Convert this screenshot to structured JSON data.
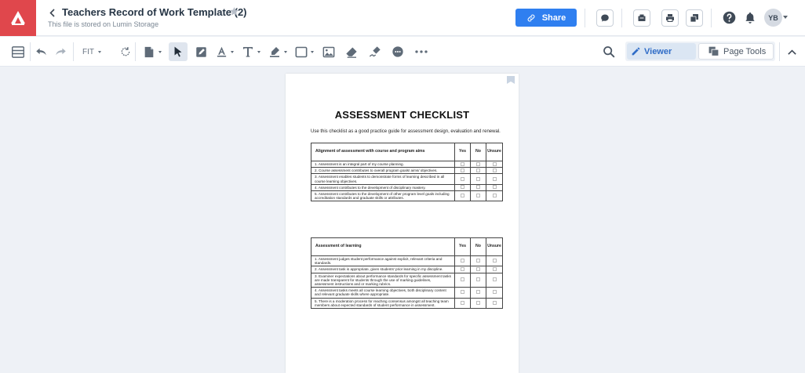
{
  "header": {
    "title": "Teachers Record of Work Template (2)",
    "subtitle": "This file is stored on Lumin Storage",
    "share_label": "Share",
    "avatar_initials": "YB"
  },
  "toolbar": {
    "zoom_label": "FIT",
    "tabs": [
      {
        "label": "Viewer",
        "active": true
      },
      {
        "label": "Page Tools",
        "active": false
      }
    ]
  },
  "document": {
    "title": "ASSESSMENT CHECKLIST",
    "intro": "Use this checklist as a good practice guide for assessment design, evaluation and renewal.",
    "columns": [
      "Yes",
      "No",
      "Unsure"
    ],
    "sections": [
      {
        "heading": "Alignment of assessment with course and program aims",
        "rows": [
          "1. Assessment is an integral part of my course planning.",
          "2. Course assessment contributes to overall program goals/ aims/ objectives.",
          "3. Assessment enables students to demonstrate forms of learning described in all course learning objectives.",
          "4. Assessment contributes to the development of disciplinary mastery.",
          "5. Assessment contributes to the development of other program level goals including accreditation standards and graduate skills or attributes."
        ]
      },
      {
        "heading": "Assessment of learning",
        "rows": [
          "1. Assessment judges student performance against explicit, relevant criteria and standards.",
          "2. Assessment task is appropriate, given students' prior learning in my discipline.",
          "3. Examiner expectations about performance standards for specific assessment tasks are made transparent for students through the use of marking guidelines, assessment instructions and or marking rubrics.",
          "4. Assessment tasks meets all course learning objectives, both disciplinary content and relevant graduate skills where appropriate.",
          "5. There is a moderation process for reaching consensus amongst all teaching team members about expected standards of student performance in assessment."
        ]
      }
    ]
  },
  "colors": {
    "brand": "#e0474c",
    "accent": "#2f7ff0"
  }
}
